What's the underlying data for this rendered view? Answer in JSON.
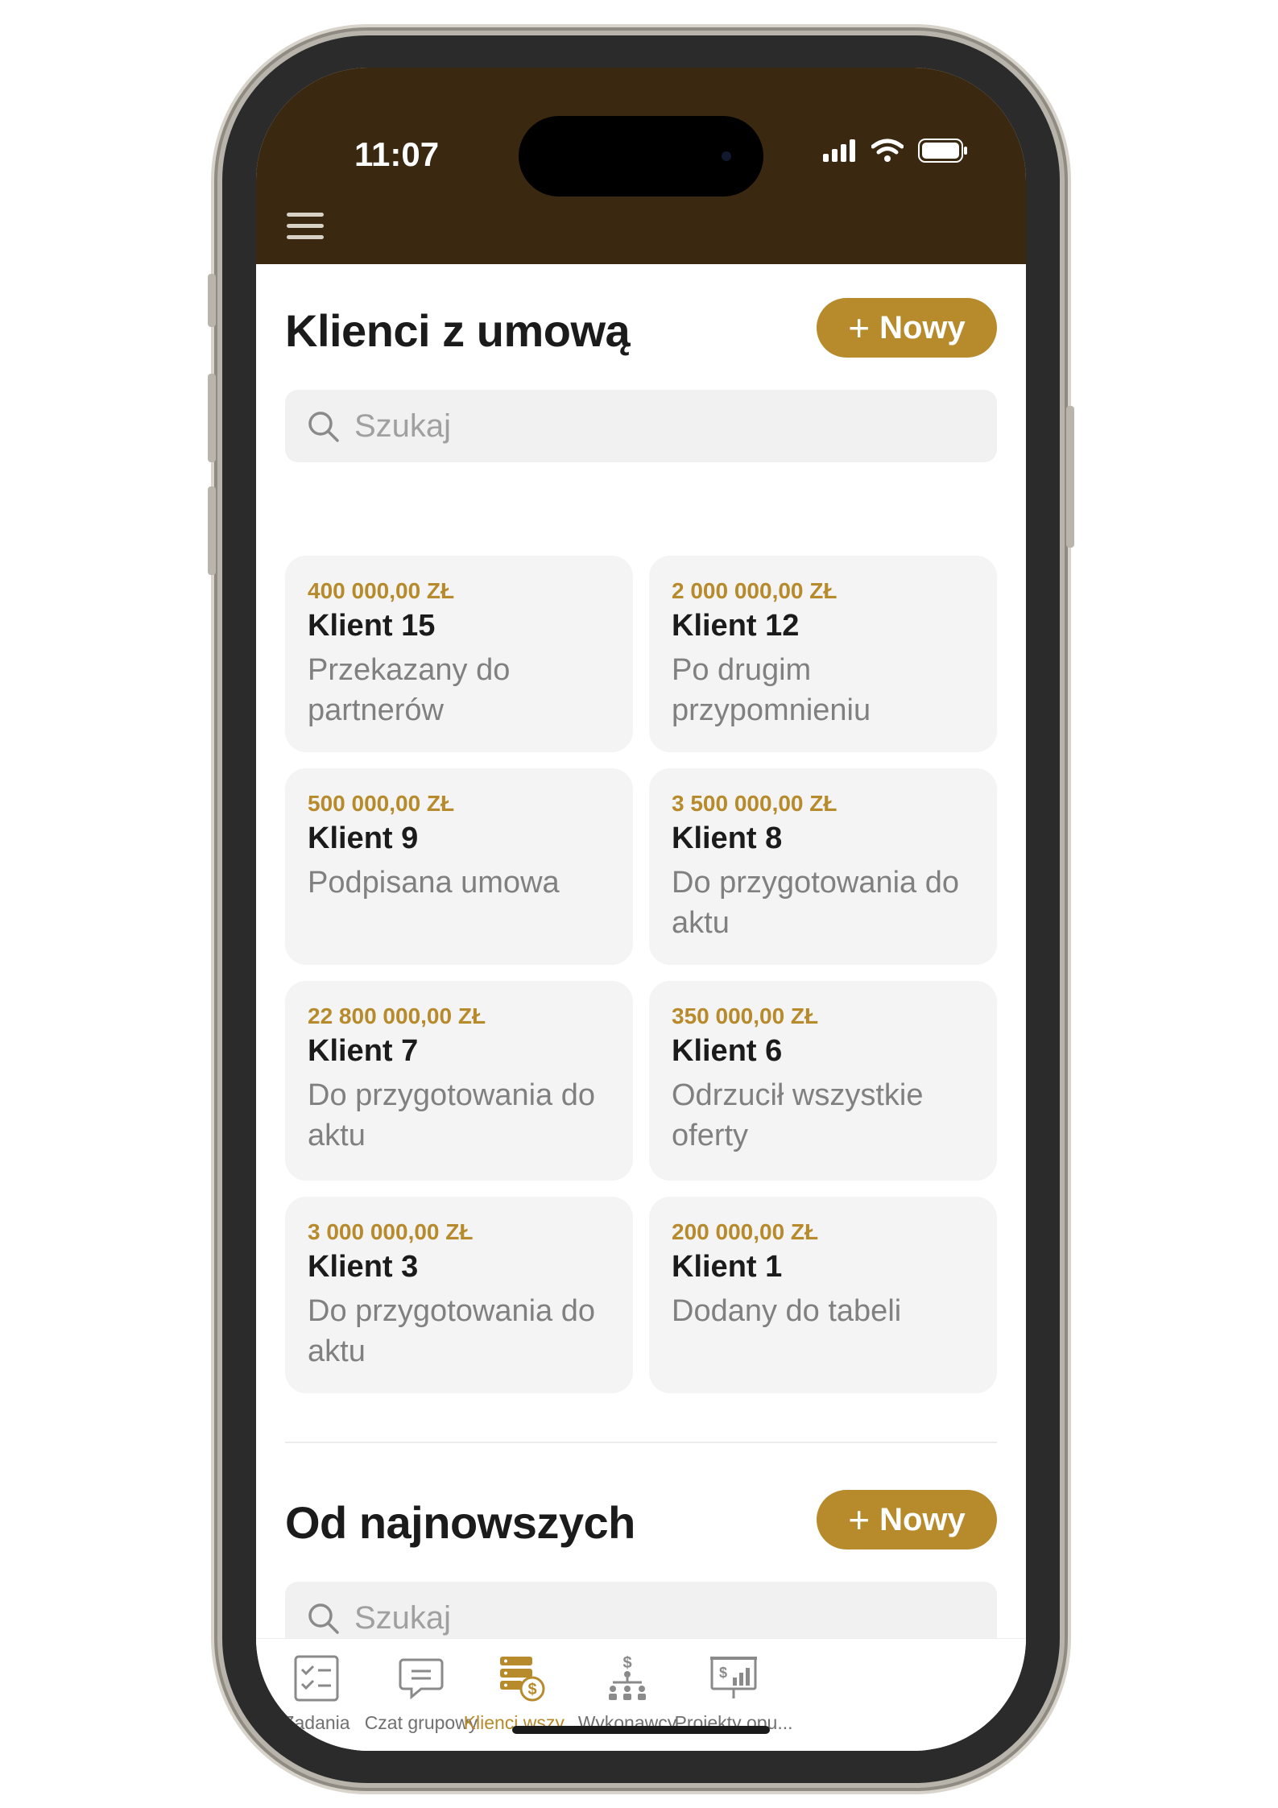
{
  "status_bar": {
    "time": "11:07"
  },
  "section1": {
    "title": "Klienci z umową",
    "new_button": "Nowy",
    "search_placeholder": "Szukaj",
    "clients": [
      {
        "amount": "400 000,00 ZŁ",
        "name": "Klient 15",
        "status": "Przekazany do partnerów"
      },
      {
        "amount": "2 000 000,00 ZŁ",
        "name": "Klient 12",
        "status": "Po drugim przypomnieniu"
      },
      {
        "amount": "500 000,00 ZŁ",
        "name": "Klient 9",
        "status": "Podpisana umowa"
      },
      {
        "amount": "3 500 000,00 ZŁ",
        "name": "Klient 8",
        "status": "Do przygotowania do aktu"
      },
      {
        "amount": "22 800 000,00 ZŁ",
        "name": "Klient 7",
        "status": "Do przygotowania do aktu"
      },
      {
        "amount": "350 000,00 ZŁ",
        "name": "Klient 6",
        "status": "Odrzucił wszystkie oferty"
      },
      {
        "amount": "3 000 000,00 ZŁ",
        "name": "Klient 3",
        "status": "Do przygotowania do aktu"
      },
      {
        "amount": "200 000,00 ZŁ",
        "name": "Klient 1",
        "status": "Dodany do tabeli"
      }
    ]
  },
  "section2": {
    "title": "Od najnowszych",
    "new_button": "Nowy",
    "search_placeholder": "Szukaj"
  },
  "bottom_nav": {
    "items": [
      {
        "label": "Zadania",
        "icon": "tasks-icon"
      },
      {
        "label": "Czat grupowy",
        "icon": "chat-icon"
      },
      {
        "label": "Klienci wszy...",
        "icon": "clients-money-icon"
      },
      {
        "label": "Wykonawcy",
        "icon": "contractors-icon"
      },
      {
        "label": "Projekty opu...",
        "icon": "projects-icon"
      }
    ],
    "active_index": 2
  },
  "colors": {
    "accent": "#b78a2b",
    "header": "#3a2810",
    "card": "#f4f4f4"
  }
}
